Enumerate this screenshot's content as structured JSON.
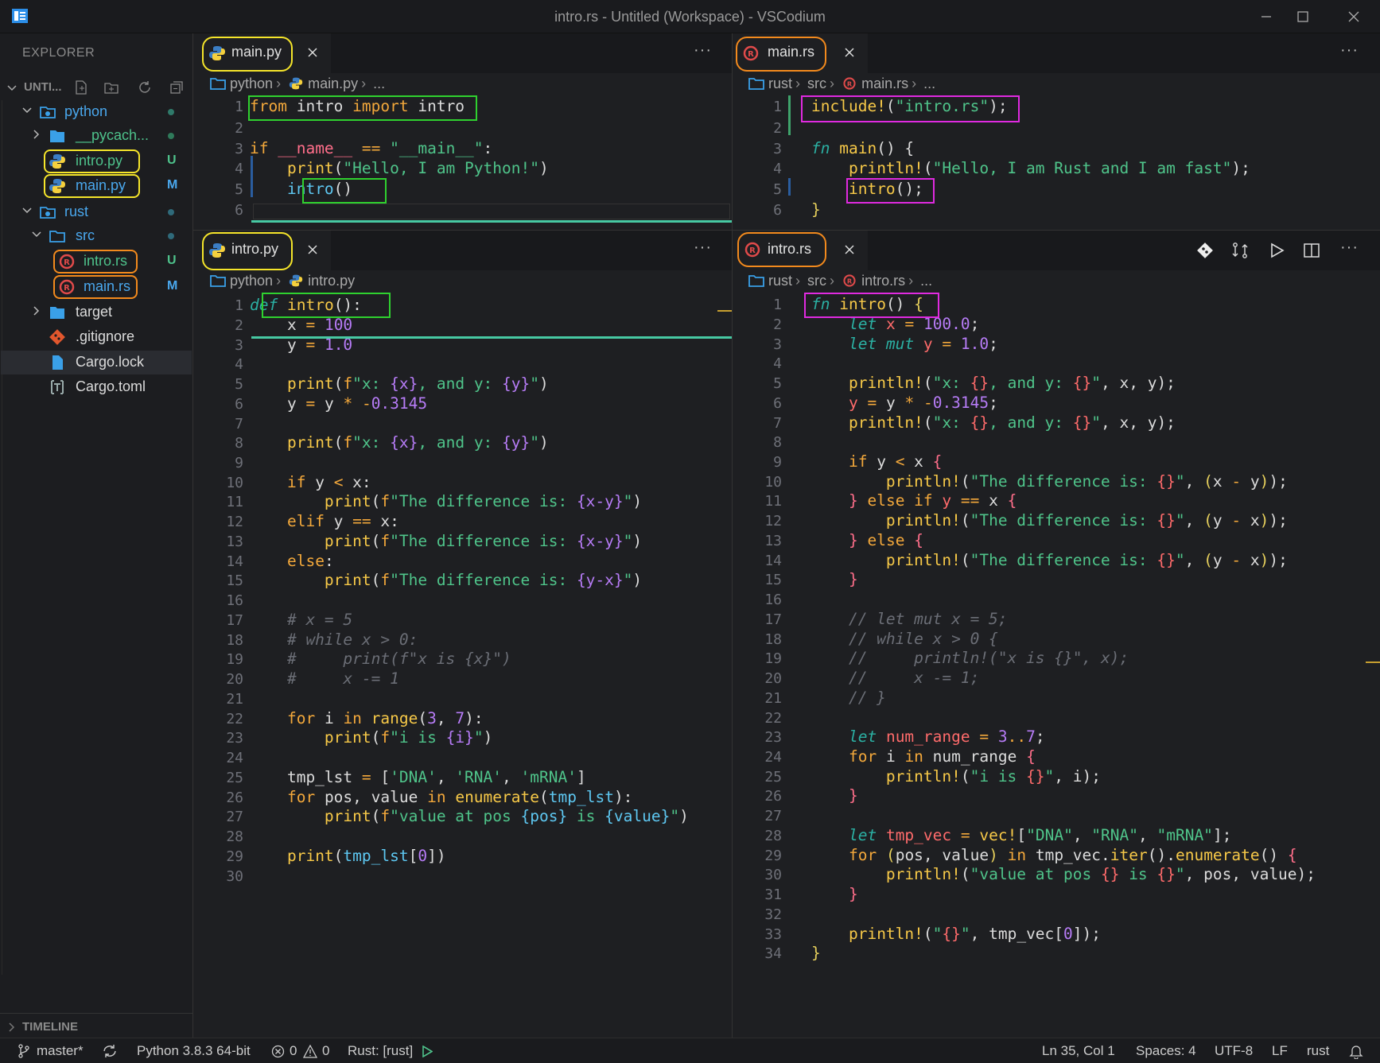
{
  "window": {
    "title": "intro.rs - Untitled (Workspace) - VSCodium"
  },
  "sidebar": {
    "title": "EXPLORER",
    "workspace_label": "UNTI...",
    "timeline_label": "TIMELINE",
    "tree": [
      {
        "label": "python",
        "status": "",
        "kind": "folder"
      },
      {
        "label": "__pycach...",
        "status": "",
        "kind": "folder"
      },
      {
        "label": "intro.py",
        "status": "U",
        "kind": "py"
      },
      {
        "label": "main.py",
        "status": "M",
        "kind": "py"
      },
      {
        "label": "rust",
        "status": "",
        "kind": "folder"
      },
      {
        "label": "src",
        "status": "",
        "kind": "folder"
      },
      {
        "label": "intro.rs",
        "status": "U",
        "kind": "rs"
      },
      {
        "label": "main.rs",
        "status": "M",
        "kind": "rs"
      },
      {
        "label": "target",
        "status": "",
        "kind": "folder"
      },
      {
        "label": ".gitignore",
        "status": "",
        "kind": "git"
      },
      {
        "label": "Cargo.lock",
        "status": "",
        "kind": "file"
      },
      {
        "label": "Cargo.toml",
        "status": "",
        "kind": "toml"
      }
    ]
  },
  "editors": {
    "main_py": {
      "tab": "main.py",
      "crumbs": [
        "python",
        "main.py",
        "..."
      ]
    },
    "main_rs": {
      "tab": "main.rs",
      "crumbs": [
        "rust",
        "src",
        "main.rs",
        "..."
      ]
    },
    "intro_py": {
      "tab": "intro.py",
      "crumbs": [
        "python",
        "intro.py"
      ]
    },
    "intro_rs": {
      "tab": "intro.rs",
      "crumbs": [
        "rust",
        "src",
        "intro.rs",
        "..."
      ]
    }
  },
  "more_label": "···",
  "statusbar": {
    "branch": "master*",
    "python": "Python 3.8.3 64-bit",
    "errors": "0",
    "warnings": "0",
    "rust": "Rust: [rust]",
    "position": "Ln 35, Col 1",
    "spaces": "Spaces: 4",
    "encoding": "UTF-8",
    "eol": "LF",
    "language": "rust"
  },
  "colors": {
    "yellow_box": "#f5e52a",
    "orange_box": "#f38a1d",
    "green_box": "#2fd12f",
    "magenta_box": "#e02ae0",
    "accent_line": "#47c9a3"
  }
}
